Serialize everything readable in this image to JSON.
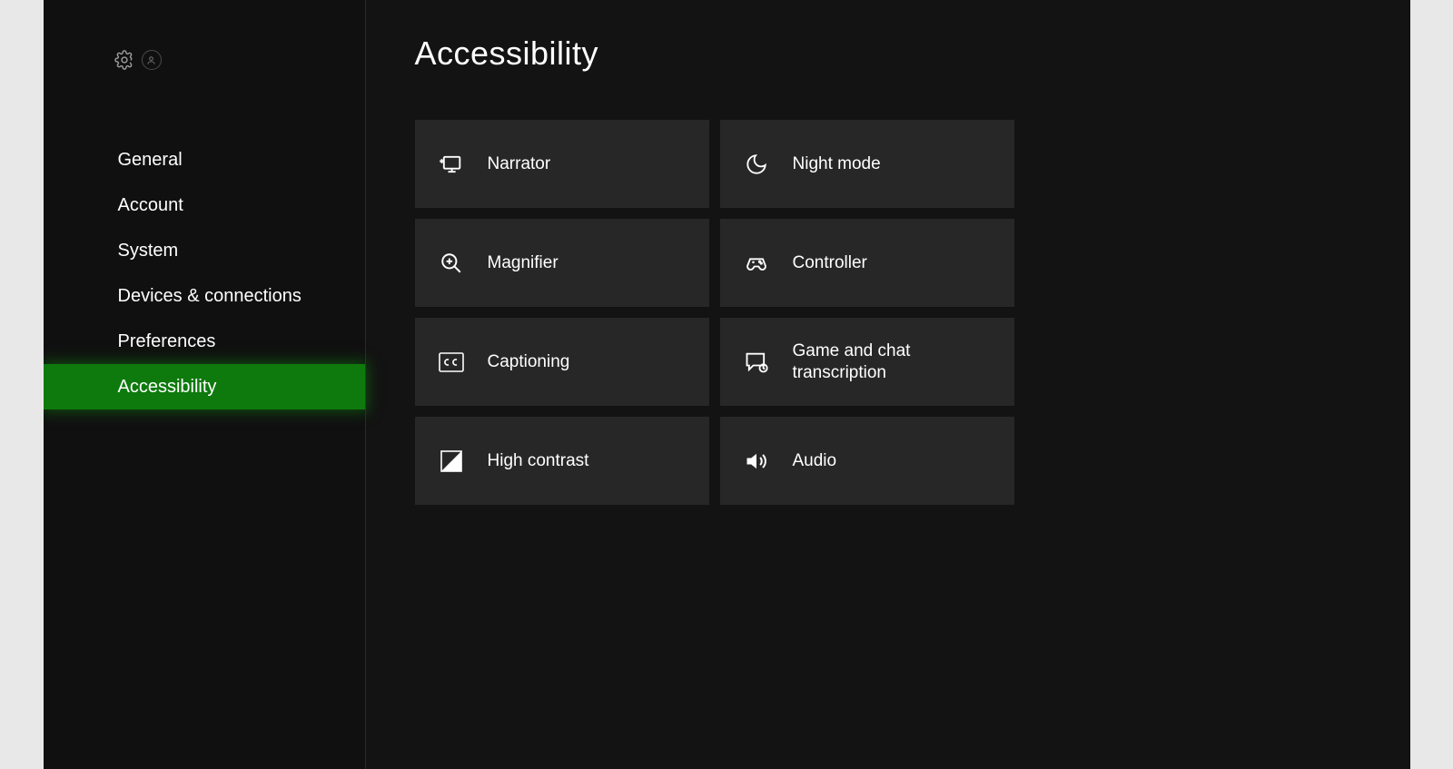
{
  "page": {
    "title": "Accessibility"
  },
  "sidebar": {
    "items": [
      {
        "id": "general",
        "label": "General",
        "active": false
      },
      {
        "id": "account",
        "label": "Account",
        "active": false
      },
      {
        "id": "system",
        "label": "System",
        "active": false
      },
      {
        "id": "devices",
        "label": "Devices & connections",
        "active": false
      },
      {
        "id": "preferences",
        "label": "Preferences",
        "active": false
      },
      {
        "id": "accessibility",
        "label": "Accessibility",
        "active": true
      }
    ]
  },
  "tiles": [
    {
      "id": "narrator",
      "icon": "narrator-icon",
      "label": "Narrator"
    },
    {
      "id": "night-mode",
      "icon": "night-mode-icon",
      "label": "Night mode"
    },
    {
      "id": "magnifier",
      "icon": "magnifier-icon",
      "label": "Magnifier"
    },
    {
      "id": "controller",
      "icon": "controller-icon",
      "label": "Controller"
    },
    {
      "id": "captioning",
      "icon": "captioning-icon",
      "label": "Captioning"
    },
    {
      "id": "transcription",
      "icon": "transcription-icon",
      "label": "Game and chat transcription"
    },
    {
      "id": "high-contrast",
      "icon": "high-contrast-icon",
      "label": "High contrast"
    },
    {
      "id": "audio",
      "icon": "audio-icon",
      "label": "Audio"
    }
  ]
}
